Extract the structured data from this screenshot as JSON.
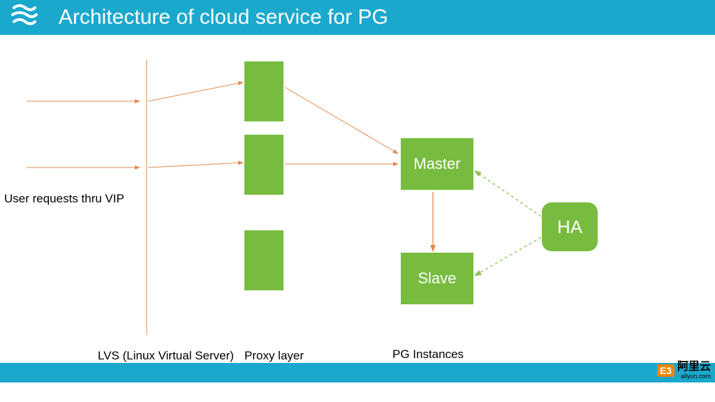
{
  "header": {
    "title": "Architecture of cloud service for PG"
  },
  "labels": {
    "user_requests": "User requests thru VIP",
    "lvs": "LVS (Linux Virtual Server)",
    "proxy": "Proxy layer",
    "pg_instances": "PG Instances"
  },
  "nodes": {
    "master": "Master",
    "slave": "Slave",
    "ha": "HA"
  },
  "brand": {
    "logo_small": "E3",
    "text": "阿里云",
    "url": "aliyun.com"
  },
  "colors": {
    "accent": "#1BA8CD",
    "node": "#77BC3F",
    "arrow": "#E28A4A"
  }
}
